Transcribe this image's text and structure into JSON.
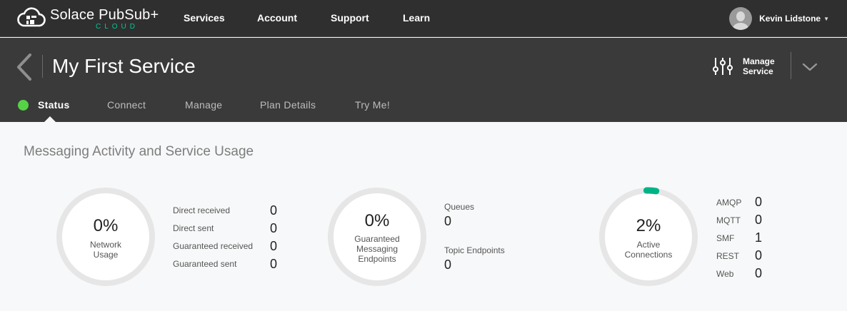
{
  "brand": {
    "name": "Solace PubSub+",
    "sub": "CLOUD",
    "accent": "#00c895"
  },
  "nav": {
    "links": [
      "Services",
      "Account",
      "Support",
      "Learn"
    ],
    "user": "Kevin Lidstone"
  },
  "service": {
    "title": "My First Service",
    "manage_label": "Manage Service",
    "tabs": [
      "Status",
      "Connect",
      "Manage",
      "Plan Details",
      "Try Me!"
    ],
    "status_color": "#56d246"
  },
  "main": {
    "section_title": "Messaging Activity and Service Usage",
    "network": {
      "percent": "0%",
      "label": [
        "Network",
        "Usage"
      ],
      "stats": [
        {
          "label": "Direct received",
          "value": "0"
        },
        {
          "label": "Direct sent",
          "value": "0"
        },
        {
          "label": "Guaranteed received",
          "value": "0"
        },
        {
          "label": "Guaranteed sent",
          "value": "0"
        }
      ]
    },
    "endpoints": {
      "percent": "0%",
      "label": [
        "Guaranteed",
        "Messaging",
        "Endpoints"
      ],
      "stats": [
        {
          "label": "Queues",
          "value": "0"
        },
        {
          "label": "Topic Endpoints",
          "value": "0"
        }
      ]
    },
    "connections": {
      "percent": "2%",
      "fraction": 0.02,
      "label": [
        "Active",
        "Connections"
      ],
      "stats": [
        {
          "label": "AMQP",
          "value": "0"
        },
        {
          "label": "MQTT",
          "value": "0"
        },
        {
          "label": "SMF",
          "value": "1"
        },
        {
          "label": "REST",
          "value": "0"
        },
        {
          "label": "Web",
          "value": "0"
        }
      ]
    }
  }
}
